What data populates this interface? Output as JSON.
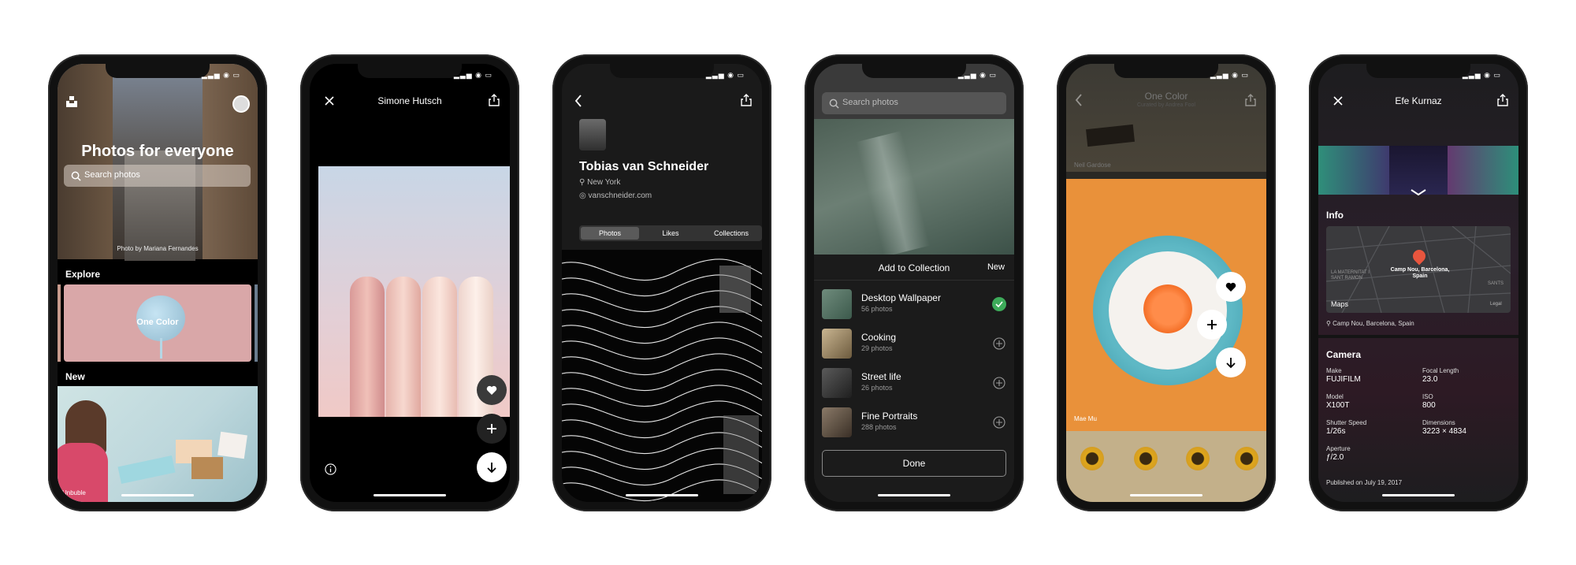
{
  "status_bar": "▂▃▅ ◉ ▭",
  "phone1": {
    "title": "Photos for everyone",
    "search_placeholder": "Search photos",
    "photo_credit": "Photo by Mariana Fernandes",
    "explore_label": "Explore",
    "collection_label": "One Color",
    "new_label": "New",
    "bottom_credit": "Unbuble"
  },
  "phone2": {
    "title": "Simone Hutsch"
  },
  "phone3": {
    "name": "Tobias van Schneider",
    "location": "New York",
    "website": "vanschneider.com",
    "tabs": [
      "Photos",
      "Likes",
      "Collections"
    ]
  },
  "phone4": {
    "search_placeholder": "Search photos",
    "sheet_title": "Add to Collection",
    "new_label": "New",
    "collections": [
      {
        "name": "Desktop Wallpaper",
        "count": "56 photos",
        "added": true
      },
      {
        "name": "Cooking",
        "count": "29 photos",
        "added": false
      },
      {
        "name": "Street life",
        "count": "26 photos",
        "added": false
      },
      {
        "name": "Fine Portraits",
        "count": "288 photos",
        "added": false
      }
    ],
    "done_label": "Done"
  },
  "phone5": {
    "title": "One Color",
    "subtitle": "Curated by Andrea Fool",
    "credit_top": "Neil Gardose",
    "credit_main": "Mae Mu"
  },
  "phone6": {
    "title": "Efe Kurnaz",
    "info_label": "Info",
    "map_pin_label": "Camp Nou, Barcelona, Spain",
    "map_district": "LA MATERNITAT I SANT RAMON",
    "map_district2": "SANTS",
    "map_brand": "Maps",
    "map_legal": "Legal",
    "location": "Camp Nou, Barcelona, Spain",
    "camera_label": "Camera",
    "fields": [
      {
        "label": "Make",
        "value": "FUJIFILM"
      },
      {
        "label": "Focal Length",
        "value": "23.0"
      },
      {
        "label": "Model",
        "value": "X100T"
      },
      {
        "label": "ISO",
        "value": "800"
      },
      {
        "label": "Shutter Speed",
        "value": "1/26s"
      },
      {
        "label": "Dimensions",
        "value": "3223 × 4834"
      },
      {
        "label": "Aperture",
        "value": "ƒ/2.0"
      }
    ],
    "published": "Published on July 19, 2017"
  }
}
